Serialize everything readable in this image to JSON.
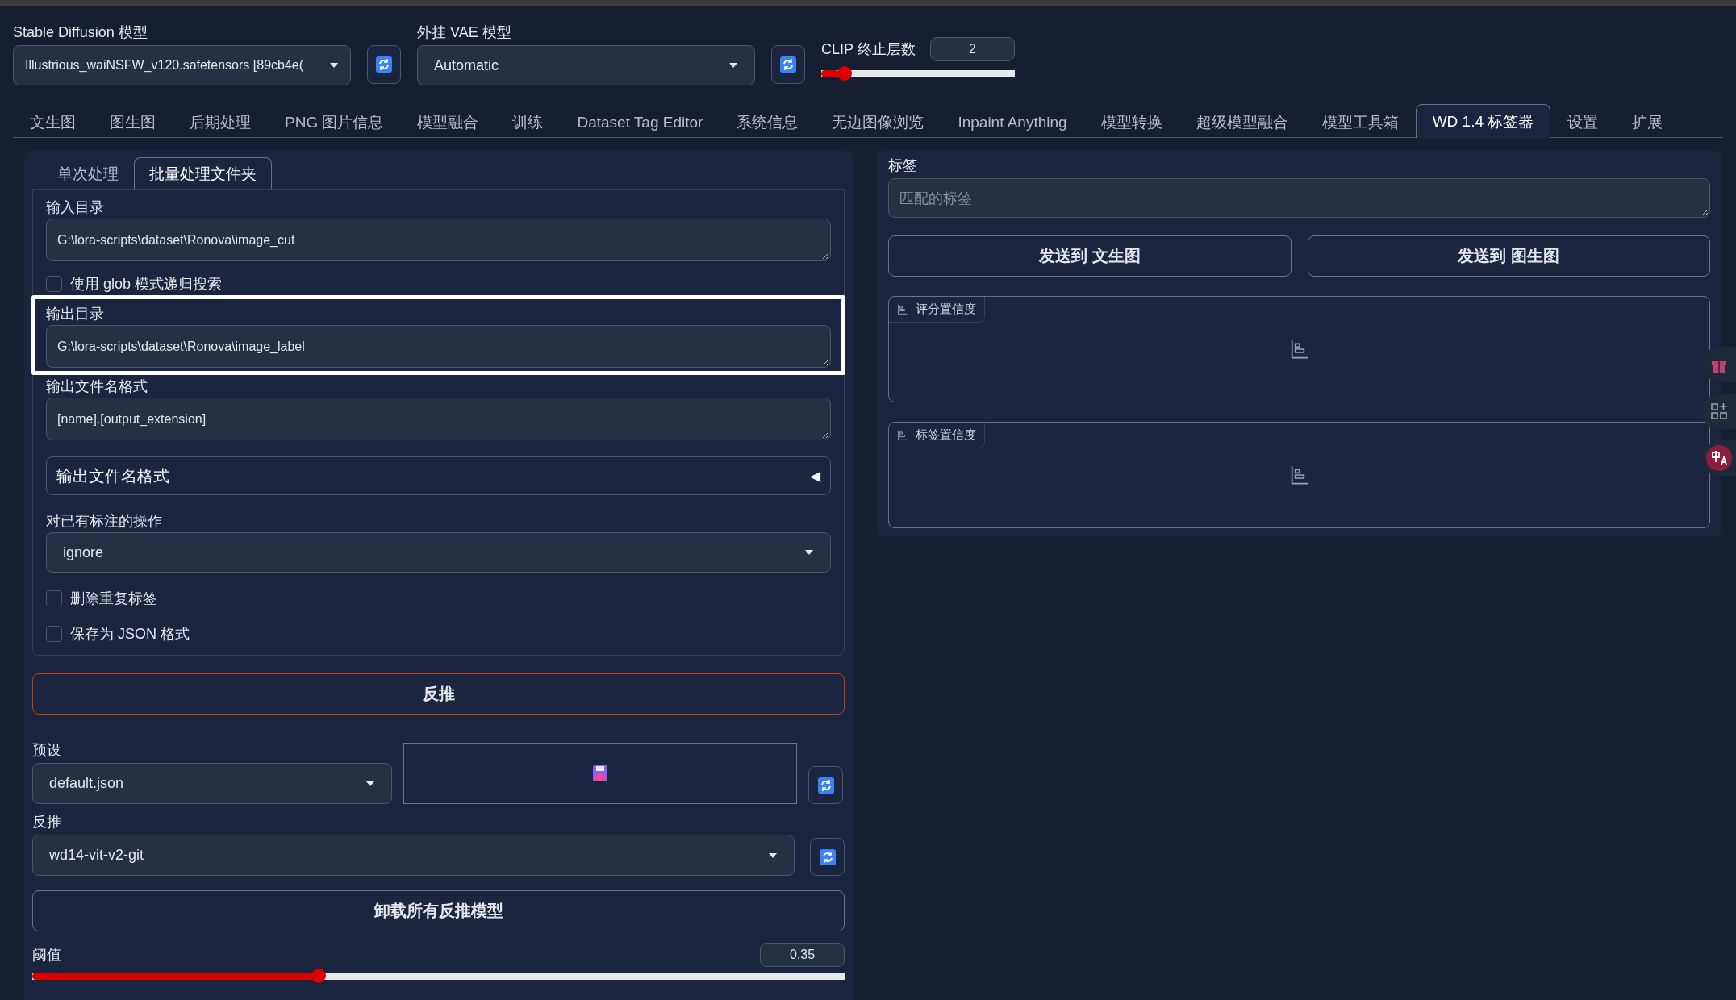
{
  "top": {
    "model": {
      "label": "Stable Diffusion 模型",
      "value": "Illustrious_waiNSFW_v120.safetensors [89cb4e("
    },
    "vae": {
      "label": "外挂 VAE 模型",
      "value": "Automatic"
    },
    "clip": {
      "label": "CLIP 终止层数",
      "value": "2",
      "level": 0.09
    }
  },
  "tabs": [
    {
      "label": "文生图",
      "selected": false
    },
    {
      "label": "图生图",
      "selected": false
    },
    {
      "label": "后期处理",
      "selected": false
    },
    {
      "label": "PNG 图片信息",
      "selected": false
    },
    {
      "label": "模型融合",
      "selected": false
    },
    {
      "label": "训练",
      "selected": false
    },
    {
      "label": "Dataset Tag Editor",
      "selected": false
    },
    {
      "label": "系统信息",
      "selected": false
    },
    {
      "label": "无边图像浏览",
      "selected": false
    },
    {
      "label": "Inpaint Anything",
      "selected": false
    },
    {
      "label": "模型转换",
      "selected": false
    },
    {
      "label": "超级模型融合",
      "selected": false
    },
    {
      "label": "模型工具箱",
      "selected": false
    },
    {
      "label": "WD 1.4 标签器",
      "selected": true
    },
    {
      "label": "设置",
      "selected": false
    },
    {
      "label": "扩展",
      "selected": false
    }
  ],
  "left": {
    "subtabs": [
      {
        "label": "单次处理",
        "selected": false
      },
      {
        "label": "批量处理文件夹",
        "selected": true
      }
    ],
    "input_dir": {
      "label": "输入目录",
      "value": "G:\\lora-scripts\\dataset\\Ronova\\image_cut"
    },
    "glob_search": {
      "label": "使用 glob 模式递归搜索",
      "checked": false
    },
    "output_dir": {
      "label": "输出目录",
      "value": "G:\\lora-scripts\\dataset\\Ronova\\image_label",
      "highlighted": true
    },
    "filename_format": {
      "label": "输出文件名格式",
      "value": "[name].[output_extension]"
    },
    "accordion": {
      "label": "输出文件名格式",
      "toggle": "◀",
      "expanded": false
    },
    "existing_action": {
      "label": "对已有标注的操作",
      "value": "ignore"
    },
    "options": [
      {
        "label": "删除重复标签",
        "checked": false
      },
      {
        "label": "保存为 JSON 格式",
        "checked": false
      }
    ],
    "interrogate_button": "反推",
    "preset": {
      "label": "预设",
      "value": "default.json"
    },
    "interrogator": {
      "label": "反推",
      "value": "wd14-vit-v2-git"
    },
    "unload_button": "卸载所有反推模型",
    "threshold": {
      "label": "阈值",
      "value": "0.35",
      "level": 0.35
    }
  },
  "right": {
    "tags": {
      "label": "标签",
      "placeholder": "匹配的标签"
    },
    "send_buttons": [
      "发送到 文生图",
      "发送到 图生图"
    ],
    "plots": [
      {
        "label": "评分置信度"
      },
      {
        "label": "标签置信度"
      }
    ]
  }
}
